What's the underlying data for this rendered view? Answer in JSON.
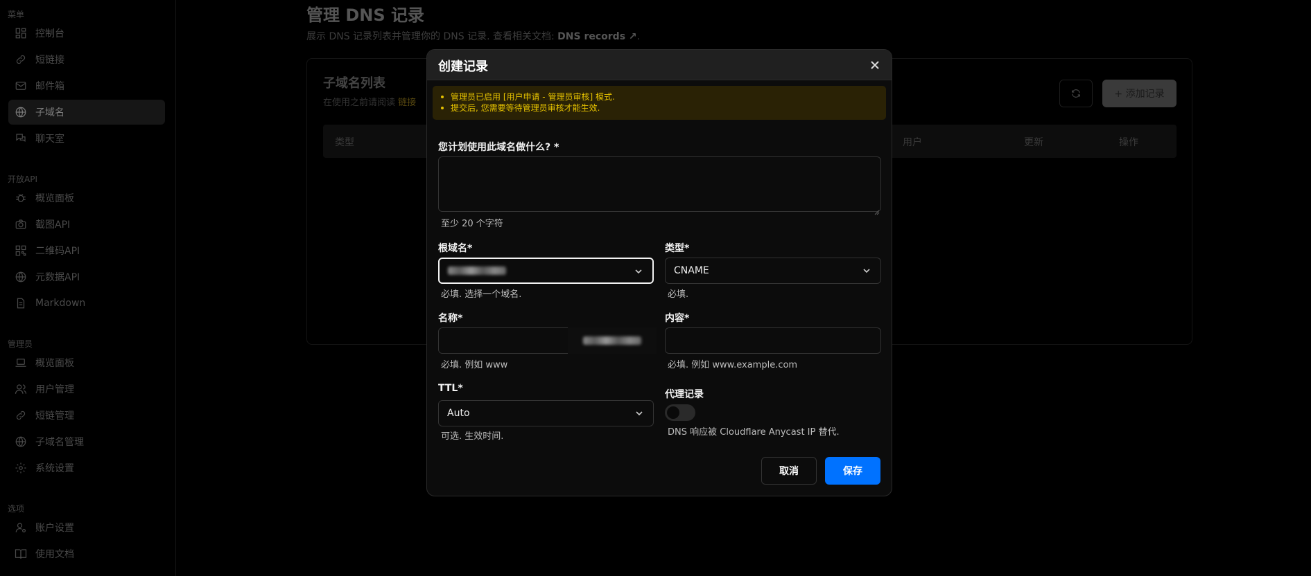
{
  "sidebar": {
    "sections": [
      {
        "label": "菜单",
        "items": [
          {
            "label": "控制台",
            "icon": "dashboard-icon",
            "active": false
          },
          {
            "label": "短链接",
            "icon": "link-icon",
            "active": false
          },
          {
            "label": "邮件箱",
            "icon": "mail-icon",
            "active": false
          },
          {
            "label": "子域名",
            "icon": "globe-icon",
            "active": true
          },
          {
            "label": "聊天室",
            "icon": "chat-icon",
            "active": false
          }
        ]
      },
      {
        "label": "开放API",
        "items": [
          {
            "label": "概览面板",
            "icon": "bug-icon",
            "active": false
          },
          {
            "label": "截图API",
            "icon": "camera-icon",
            "active": false
          },
          {
            "label": "二维码API",
            "icon": "qrcode-icon",
            "active": false
          },
          {
            "label": "元数据API",
            "icon": "globe-icon",
            "active": false
          },
          {
            "label": "Markdown",
            "icon": "file-icon",
            "active": false
          }
        ]
      },
      {
        "label": "管理员",
        "items": [
          {
            "label": "概览面板",
            "icon": "laptop-icon",
            "active": false
          },
          {
            "label": "用户管理",
            "icon": "users-icon",
            "active": false
          },
          {
            "label": "短链管理",
            "icon": "link-icon",
            "active": false
          },
          {
            "label": "子域名管理",
            "icon": "globe-icon",
            "active": false
          },
          {
            "label": "系统设置",
            "icon": "gear-icon",
            "active": false
          }
        ]
      },
      {
        "label": "选项",
        "items": [
          {
            "label": "账户设置",
            "icon": "user-gear-icon",
            "active": false
          },
          {
            "label": "使用文档",
            "icon": "book-icon",
            "active": false
          }
        ]
      }
    ]
  },
  "page": {
    "title": "管理 DNS 记录",
    "desc_prefix": "展示 DNS 记录列表并管理你的 DNS 记录. 查看相关文档: ",
    "desc_link": "DNS records ↗",
    "desc_suffix": ".",
    "card_title": "子域名列表",
    "card_desc_prefix": "在使用之前请阅读 ",
    "card_desc_link": "链接",
    "add_button": "+ 添加记录",
    "table_headers": {
      "type": "类型",
      "user": "用户",
      "updated": "更新",
      "actions": "操作"
    }
  },
  "modal": {
    "title": "创建记录",
    "notice": [
      "管理员已启用 [用户申请 - 管理员审核] 模式.",
      "提交后, 您需要等待管理员审核才能生效."
    ],
    "purpose": {
      "label": "您计划使用此域名做什么? *",
      "value": "",
      "help": "至少 20 个字符"
    },
    "root_domain": {
      "label": "根域名*",
      "help": "必填. 选择一个域名."
    },
    "type": {
      "label": "类型*",
      "value": "CNAME",
      "help": "必填."
    },
    "name": {
      "label": "名称*",
      "value": "",
      "help": "必填. 例如 www"
    },
    "content": {
      "label": "内容*",
      "value": "",
      "help": "必填. 例如 www.example.com"
    },
    "ttl": {
      "label": "TTL*",
      "value": "Auto",
      "help": "可选. 生效时间."
    },
    "proxy": {
      "label": "代理记录",
      "enabled": false,
      "help": "DNS 响应被 Cloudflare Anycast IP 替代."
    },
    "cancel_label": "取消",
    "save_label": "保存"
  }
}
